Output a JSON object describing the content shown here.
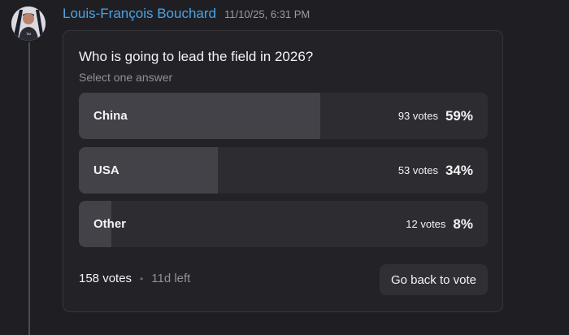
{
  "message": {
    "author": "Louis-François Bouchard",
    "timestamp": "11/10/25, 6:31 PM"
  },
  "poll": {
    "question": "Who is going to lead the field in 2026?",
    "hint": "Select one answer",
    "options": [
      {
        "label": "China",
        "votes": "93 votes",
        "percent": "59%",
        "fraction": 0.59
      },
      {
        "label": "USA",
        "votes": "53 votes",
        "percent": "34%",
        "fraction": 0.34
      },
      {
        "label": "Other",
        "votes": "12 votes",
        "percent": "8%",
        "fraction": 0.08
      }
    ],
    "total_votes": "158 votes",
    "separator": "•",
    "time_left": "11d left",
    "back_button": "Go back to vote"
  },
  "icons": {
    "avatar": "user-avatar"
  },
  "colors": {
    "background": "#1f1f23",
    "card": "#232327",
    "author": "#4aa3e8",
    "option_track": "#2c2c31",
    "option_fill": "#424248"
  }
}
